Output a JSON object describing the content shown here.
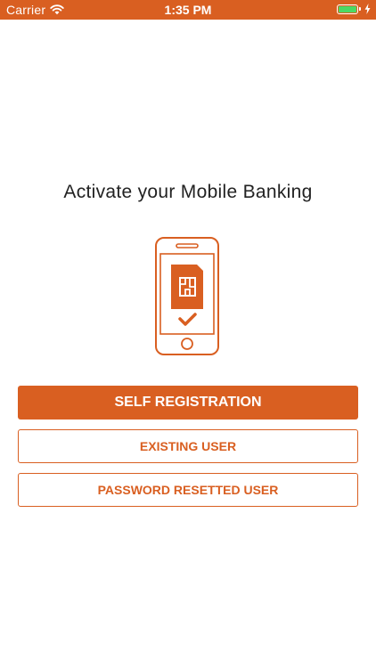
{
  "status_bar": {
    "carrier": "Carrier",
    "time": "1:35 PM",
    "wifi_icon": "wifi-icon",
    "battery_icon": "battery-icon",
    "charging_icon": "bolt-icon",
    "battery_level": 1.0,
    "background_color": "#d95f21"
  },
  "main": {
    "headline": "Activate your Mobile Banking",
    "illustration_icon": "phone-sim-check-icon",
    "buttons": {
      "self_registration": "SELF REGISTRATION",
      "existing_user": "EXISTING USER",
      "password_resetted_user": "PASSWORD RESETTED USER"
    }
  },
  "colors": {
    "accent": "#d95f21",
    "battery_green": "#4cd964",
    "text": "#222222"
  }
}
